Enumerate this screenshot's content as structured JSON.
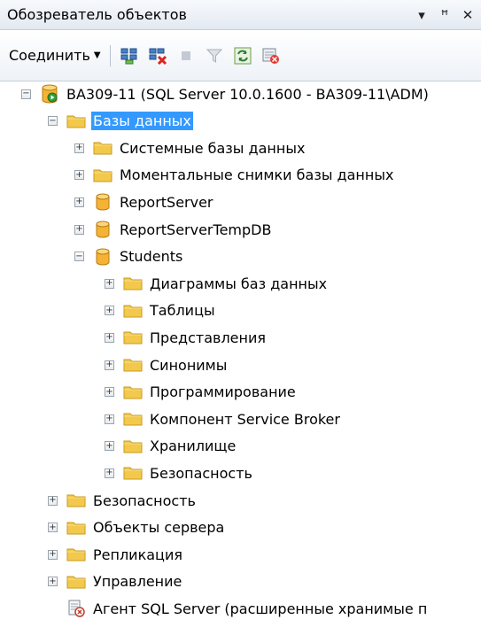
{
  "panel": {
    "title": "Обозреватель объектов",
    "pin_glyph": "▾ ꟸ",
    "close_glyph": "✕"
  },
  "toolbar": {
    "connect_label": "Соединить",
    "icons": [
      "connect-object-explorer-icon",
      "disconnect-icon",
      "stop-icon",
      "filter-icon",
      "refresh-icon",
      "activity-monitor-icon"
    ]
  },
  "tree": [
    {
      "label": "BA309-11 (SQL Server 10.0.1600 - BA309-11\\ADM)",
      "icon": "server-icon",
      "expander": "−",
      "level": 0
    },
    {
      "label": "Базы данных",
      "icon": "folder-icon",
      "expander": "−",
      "level": 1,
      "selected": true
    },
    {
      "label": "Системные базы данных",
      "icon": "folder-icon",
      "expander": "+",
      "level": 2
    },
    {
      "label": "Моментальные снимки базы данных",
      "icon": "folder-icon",
      "expander": "+",
      "level": 2
    },
    {
      "label": "ReportServer",
      "icon": "database-icon",
      "expander": "+",
      "level": 2
    },
    {
      "label": "ReportServerTempDB",
      "icon": "database-icon",
      "expander": "+",
      "level": 2
    },
    {
      "label": "Students",
      "icon": "database-icon",
      "expander": "−",
      "level": 2
    },
    {
      "label": "Диаграммы баз данных",
      "icon": "folder-icon",
      "expander": "+",
      "level": 3
    },
    {
      "label": "Таблицы",
      "icon": "folder-icon",
      "expander": "+",
      "level": 3
    },
    {
      "label": "Представления",
      "icon": "folder-icon",
      "expander": "+",
      "level": 3
    },
    {
      "label": "Синонимы",
      "icon": "folder-icon",
      "expander": "+",
      "level": 3
    },
    {
      "label": "Программирование",
      "icon": "folder-icon",
      "expander": "+",
      "level": 3
    },
    {
      "label": "Компонент Service Broker",
      "icon": "folder-icon",
      "expander": "+",
      "level": 3
    },
    {
      "label": "Хранилище",
      "icon": "folder-icon",
      "expander": "+",
      "level": 3
    },
    {
      "label": "Безопасность",
      "icon": "folder-icon",
      "expander": "+",
      "level": 3
    },
    {
      "label": "Безопасность",
      "icon": "folder-icon",
      "expander": "+",
      "level": 1
    },
    {
      "label": "Объекты сервера",
      "icon": "folder-icon",
      "expander": "+",
      "level": 1
    },
    {
      "label": "Репликация",
      "icon": "folder-icon",
      "expander": "+",
      "level": 1
    },
    {
      "label": "Управление",
      "icon": "folder-icon",
      "expander": "+",
      "level": 1
    },
    {
      "label": "Агент SQL Server (расширенные хранимые п",
      "icon": "sql-agent-icon",
      "expander": "",
      "level": 1
    }
  ],
  "colors": {
    "selection": "#3399ff",
    "folder": "#f2c94c",
    "database": "#f5b335"
  }
}
